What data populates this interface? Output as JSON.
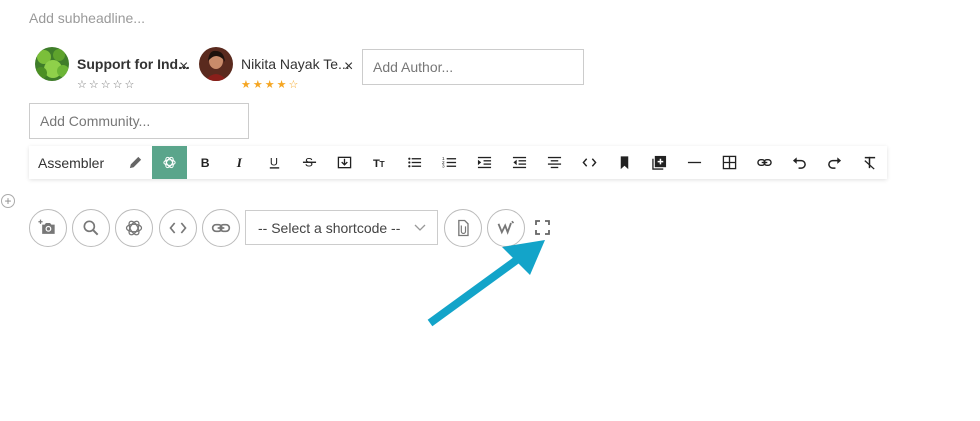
{
  "subheadline": {
    "placeholder": "Add subheadline..."
  },
  "authors": [
    {
      "name": "Support for Ind...",
      "rating": 0,
      "stars_max": 5
    },
    {
      "name": "Nikita Nayak Te...",
      "rating": 4,
      "stars_max": 5
    }
  ],
  "remove_glyph": "×",
  "author_input": {
    "placeholder": "Add Author..."
  },
  "community_input": {
    "placeholder": "Add Community..."
  },
  "toolbar": {
    "label": "Assembler",
    "buttons": [
      "pencil-icon",
      "openai-icon",
      "bold-icon",
      "italic-icon",
      "underline-icon",
      "strikethrough-icon",
      "download-icon",
      "text-size-icon",
      "bulleted-list-icon",
      "numbered-list-icon",
      "indent-icon",
      "outdent-icon",
      "align-center-icon",
      "code-icon",
      "bookmark-icon",
      "add-box-icon",
      "horizontal-rule-icon",
      "table-icon",
      "link-icon",
      "undo-icon",
      "redo-icon",
      "clear-format-icon"
    ]
  },
  "add_block_glyph": "+",
  "shortcode_select": {
    "value": "-- Select a shortcode --"
  },
  "colors": {
    "accent": "#5aa58b",
    "star": "#f5a623",
    "arrow": "#13a4c9"
  }
}
